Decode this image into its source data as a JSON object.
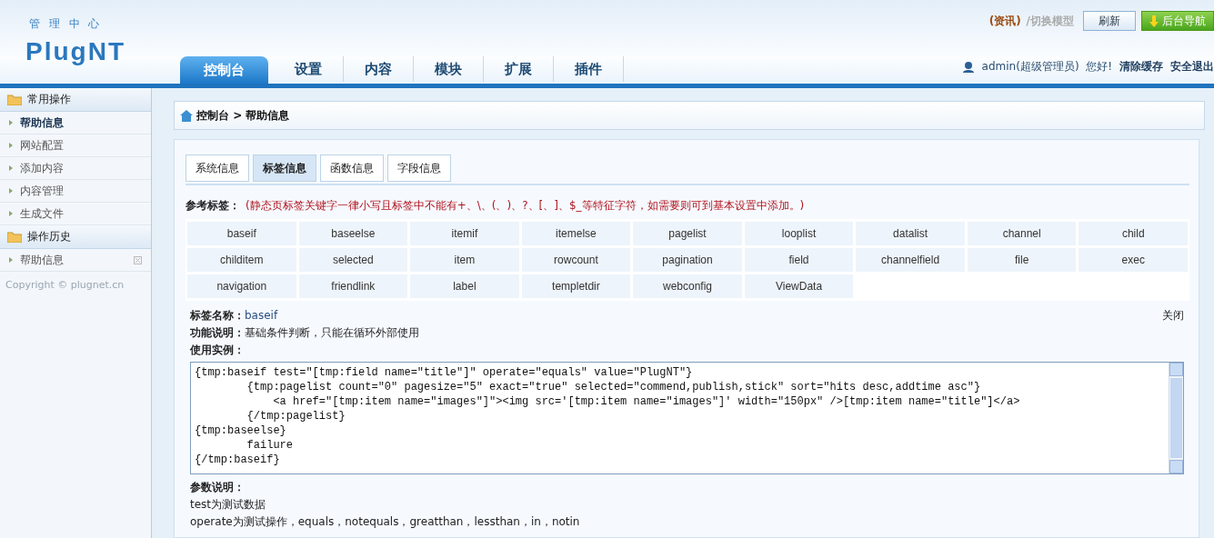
{
  "header": {
    "subtitle": "管 理 中 心",
    "logo": "PlugNT",
    "model_link": "(资讯)",
    "model_switch": "/切换模型",
    "refresh_button": "刷新",
    "nav_button": "后台导航",
    "nav": [
      {
        "label": "控制台",
        "selected": true
      },
      {
        "label": "设置",
        "selected": false
      },
      {
        "label": "内容",
        "selected": false
      },
      {
        "label": "模块",
        "selected": false
      },
      {
        "label": "扩展",
        "selected": false
      },
      {
        "label": "插件",
        "selected": false
      }
    ],
    "user": "admin(超级管理员)  您好!",
    "clear_cache": "清除缓存",
    "logout": "安全退出"
  },
  "sidebar": {
    "sections": [
      {
        "title": "常用操作",
        "items": [
          {
            "label": "帮助信息",
            "selected": true,
            "closable": false
          },
          {
            "label": "网站配置",
            "selected": false,
            "closable": false
          },
          {
            "label": "添加内容",
            "selected": false,
            "closable": false
          },
          {
            "label": "内容管理",
            "selected": false,
            "closable": false
          },
          {
            "label": "生成文件",
            "selected": false,
            "closable": false
          }
        ]
      },
      {
        "title": "操作历史",
        "items": [
          {
            "label": "帮助信息",
            "selected": false,
            "closable": true
          }
        ]
      }
    ],
    "copyright": "Copyright © plugnet.cn"
  },
  "breadcrumb": "控制台 > 帮助信息",
  "tabs": [
    {
      "label": "系统信息",
      "selected": false
    },
    {
      "label": "标签信息",
      "selected": true
    },
    {
      "label": "函数信息",
      "selected": false
    },
    {
      "label": "字段信息",
      "selected": false
    }
  ],
  "reference": {
    "label": "参考标签：",
    "note": "(静态页标签关键字一律小写且标签中不能有+、\\、(、)、?、[、]、$_等特征字符，如需要则可到基本设置中添加。)"
  },
  "tags": [
    "baseif",
    "baseelse",
    "itemif",
    "itemelse",
    "pagelist",
    "looplist",
    "datalist",
    "channel",
    "child",
    "childitem",
    "selected",
    "item",
    "rowcount",
    "pagination",
    "field",
    "channelfield",
    "file",
    "exec",
    "navigation",
    "friendlink",
    "label",
    "templetdir",
    "webconfig",
    "ViewData"
  ],
  "detail": {
    "name_label": "标签名称：",
    "name": "baseif",
    "close": "关闭",
    "func_label": "功能说明：",
    "func": "基础条件判断，只能在循环外部使用",
    "example_label": "使用实例：",
    "code": [
      "{tmp:baseif test=\"[tmp:field name=\"title\"]\" operate=\"equals\" value=\"PlugNT\"}",
      "        {tmp:pagelist count=\"0\" pagesize=\"5\" exact=\"true\" selected=\"commend,publish,stick\" sort=\"hits desc,addtime asc\"}",
      "            <a href=\"[tmp:item name=\"images\"]\"><img src='[tmp:item name=\"images\"]' width=\"150px\" />[tmp:item name=\"title\"]</a>",
      "        {/tmp:pagelist}",
      "{tmp:baseelse}",
      "        failure",
      "{/tmp:baseif}"
    ],
    "params_label": "参数说明：",
    "params": [
      "test为测试数据",
      "operate为测试操作，equals，notequals，greatthan，lessthan，in，notin"
    ]
  }
}
